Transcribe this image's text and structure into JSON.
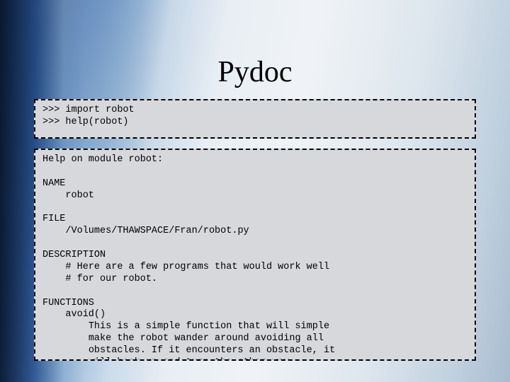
{
  "title": "Pydoc",
  "input_block": ">>> import robot\n>>> help(robot)",
  "help_block": "Help on module robot:\n\nNAME\n    robot\n\nFILE\n    /Volumes/THAWSPACE/Fran/robot.py\n\nDESCRIPTION\n    # Here are a few programs that would work well\n    # for our robot.\n\nFUNCTIONS\n    avoid()\n        This is a simple function that will simple\n        make the robot wander around avoiding all\n        obstacles. If it encounters an obstacle, it\n        will back up and turn the other way."
}
